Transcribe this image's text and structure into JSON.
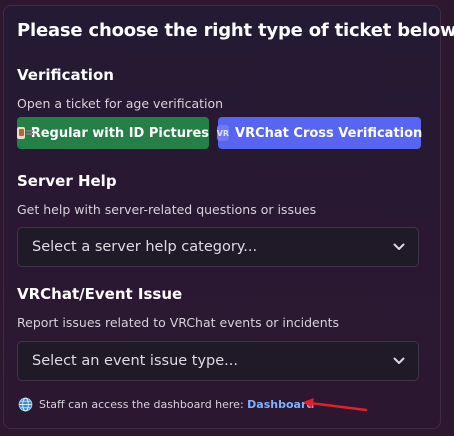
{
  "title": "Please choose the right type of ticket below:",
  "verification": {
    "heading": "Verification",
    "description": "Open a ticket for age verification",
    "buttons": [
      {
        "label": "Regular with ID Pictures",
        "icon": "id-card-icon",
        "color": "#248046"
      },
      {
        "label": "VRChat Cross Verification",
        "icon": "vr-icon",
        "color": "#5865f2"
      }
    ]
  },
  "server_help": {
    "heading": "Server Help",
    "description": "Get help with server-related questions or issues",
    "select_placeholder": "Select a server help category..."
  },
  "event_issue": {
    "heading": "VRChat/Event Issue",
    "description": "Report issues related to VRChat events or incidents",
    "select_placeholder": "Select an event issue type..."
  },
  "footer": {
    "text": "Staff can access the dashboard here: ",
    "link": "Dashboard",
    "icon": "globe-icon",
    "link_color": "#7fb2ff"
  },
  "annotation": {
    "icon": "red-arrow",
    "color": "#e0202a"
  }
}
